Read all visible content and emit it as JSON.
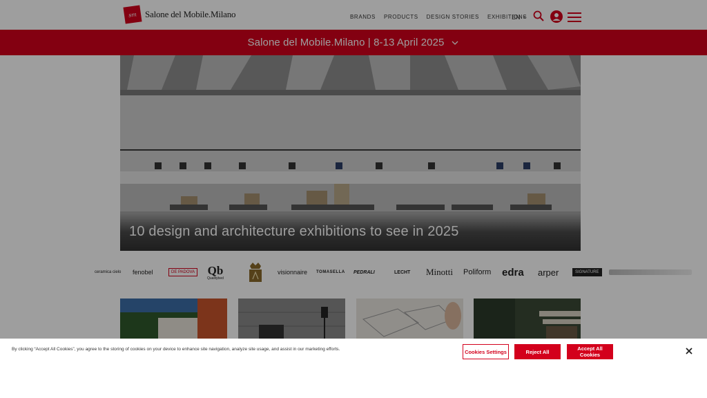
{
  "header": {
    "logo_text": "Salone del Mobile.Milano",
    "nav": [
      {
        "label": "BRANDS"
      },
      {
        "label": "PRODUCTS"
      },
      {
        "label": "DESIGN STORIES"
      },
      {
        "label": "EXHIBITIONS"
      }
    ],
    "language": "EN",
    "icons": [
      "search-icon",
      "user-icon",
      "hamburger-menu-icon"
    ]
  },
  "banner": {
    "text": "Salone del Mobile.Milano | 8-13 April 2025"
  },
  "hero": {
    "caption": "10 design and architecture exhibitions to see in 2025"
  },
  "brands": [
    {
      "label": "ceramica cielo"
    },
    {
      "label": "fenobel"
    },
    {
      "label": "DE PADOVA"
    },
    {
      "label": "Qb"
    },
    {
      "label": "Qualitybed"
    },
    {
      "label": "visionnaire"
    },
    {
      "label": "TOMASELLA"
    },
    {
      "label": "PEDRALI"
    },
    {
      "label": "LECHT"
    },
    {
      "label": "Minotti"
    },
    {
      "label": "Poliform"
    },
    {
      "label": "edra"
    },
    {
      "label": "arper"
    },
    {
      "label": "SIGNATURE"
    }
  ],
  "cookie_banner": {
    "text": "By clicking “Accept All Cookies”, you agree to the storing of cookies on your device to enhance site navigation, analyze site usage, and assist in our marketing efforts.",
    "settings_label": "Cookies Settings",
    "reject_label": "Reject All",
    "accept_label": "Accept All Cookies"
  },
  "colors": {
    "brand_red": "#d3001c",
    "overlay": "rgba(0,0,0,0.38)"
  }
}
